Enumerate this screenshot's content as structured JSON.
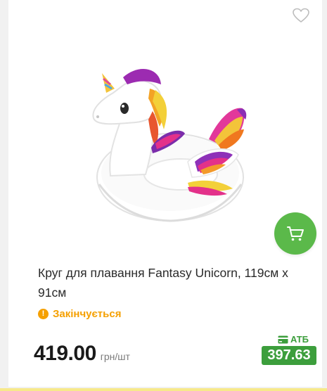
{
  "product": {
    "title": "Круг для плавання Fantasy Unicorn, 119см х 91см",
    "stock_status": "Закінчується",
    "stock_icon": "exclamation",
    "price": "419.00",
    "price_unit": "грн/шт",
    "card_label": "АТБ",
    "card_price": "397.63"
  },
  "icons": {
    "favorite": "heart-outline-icon",
    "cart": "shopping-cart-icon",
    "card": "wallet-card-icon"
  },
  "colors": {
    "cart_button": "#5bb94a",
    "stock_warning": "#f5a000",
    "card_price": "#3c9e3c"
  }
}
